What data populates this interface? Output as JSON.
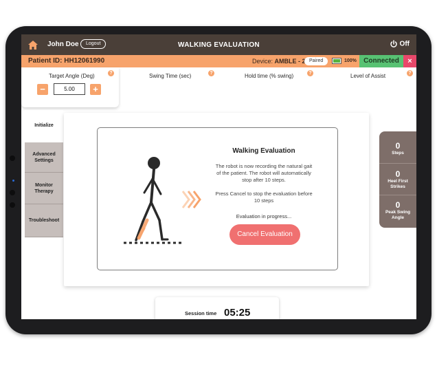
{
  "nav": {
    "user_name": "John Doe",
    "logout_label": "Logout",
    "title": "WALKING EVALUATION",
    "off_label": "Off"
  },
  "patient_bar": {
    "patient_id": "Patient ID: HH12061990",
    "device_label": "Device:",
    "device_name": "AMBLE - 21",
    "paired_label": "Paired",
    "battery_percent": "100%",
    "battery_level": 1.0,
    "connected_label": "Connected",
    "close_label": "×"
  },
  "params": {
    "target_angle_label": "Target Angle (Deg)",
    "target_angle_value": "5.00",
    "decrement_label": "−",
    "increment_label": "+",
    "swing_time_label": "Swing Time (sec)",
    "hold_time_label": "Hold time (% swing)",
    "level_assist_label": "Level of Assist",
    "help_glyph": "?"
  },
  "side_tabs": {
    "initialize": "Initialize",
    "advanced": "Advanced Settings",
    "monitor": "Monitor Therapy",
    "troubleshoot": "Troubleshoot"
  },
  "modal": {
    "title": "Walking Evaluation",
    "description": "The robot is now recording the natural gait of the patient. The robot will automatically stop after 10 steps.",
    "cancel_instruction": "Press Cancel to stop the evaluation before 10 steps",
    "progress": "Evaluation in progress...",
    "cancel_button": "Cancel Evaluation"
  },
  "stats": [
    {
      "value": "0",
      "label": "Steps"
    },
    {
      "value": "0",
      "label": "Heel First Strikes"
    },
    {
      "value": "0",
      "label": "Peak Swing Angle"
    }
  ],
  "session": {
    "label": "Session time",
    "value": "05:25"
  },
  "colors": {
    "accent": "#f7a36b",
    "nav_bg": "#4a3f38",
    "connected": "#58c273",
    "close": "#e8486a",
    "cancel_button": "#f07070",
    "stats_bg": "#7e6e69"
  },
  "icons": [
    "home-icon",
    "power-icon",
    "battery-icon",
    "help-icon",
    "walking-figure-icon",
    "chevron-arrows-icon"
  ]
}
